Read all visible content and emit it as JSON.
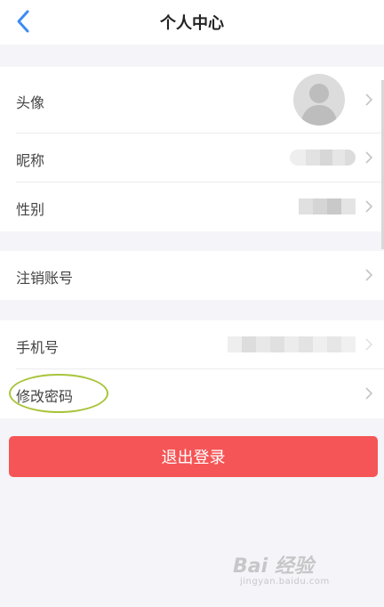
{
  "header": {
    "title": "个人中心",
    "back_icon": "chevron-left-icon"
  },
  "profile_group": {
    "avatar_label": "头像",
    "nickname_label": "昵称",
    "gender_label": "性别"
  },
  "account_group": {
    "cancel_account_label": "注销账号"
  },
  "security_group": {
    "phone_label": "手机号",
    "change_password_label": "修改密码"
  },
  "logout_button": {
    "label": "退出登录"
  },
  "watermark": {
    "text": "Bai 经验",
    "sub": "jingyan.baidu.com"
  },
  "colors": {
    "accent_blue": "#3d8bf2",
    "logout_red": "#f55556",
    "highlight_green": "#a8c43a"
  }
}
